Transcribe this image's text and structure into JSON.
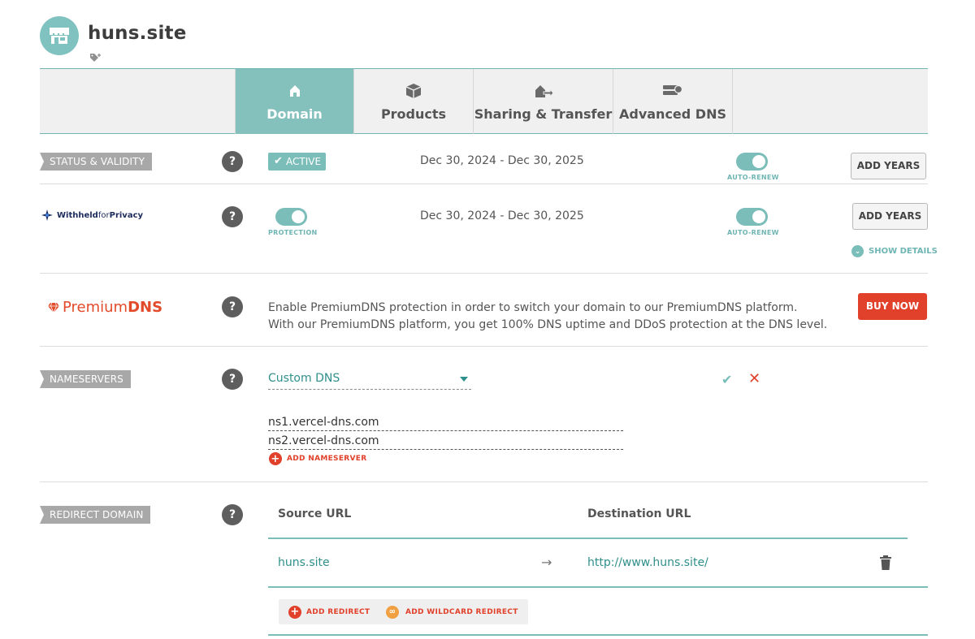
{
  "header": {
    "site_title": "huns.site"
  },
  "tabs": [
    {
      "label": "Domain",
      "icon": "home-icon",
      "active": true
    },
    {
      "label": "Products",
      "icon": "box-icon"
    },
    {
      "label": "Sharing & Transfer",
      "icon": "transfer-icon"
    },
    {
      "label": "Advanced DNS",
      "icon": "server-icon"
    }
  ],
  "status": {
    "label": "STATUS & VALIDITY",
    "badge": "ACTIVE",
    "dates": "Dec 30, 2024 - Dec 30, 2025",
    "toggle_caption": "AUTO-RENEW",
    "button": "ADD YEARS"
  },
  "privacy": {
    "logo_bold": "Withheld",
    "logo_thin": "for",
    "logo_end": "Privacy",
    "toggle_caption": "PROTECTION",
    "dates": "Dec 30, 2024 - Dec 30, 2025",
    "auto_caption": "AUTO-RENEW",
    "button": "ADD YEARS",
    "show_details": "SHOW DETAILS"
  },
  "premium": {
    "logo_thin": "Premium",
    "logo_bold": "DNS",
    "desc_line1": "Enable PremiumDNS protection in order to switch your domain to our PremiumDNS platform.",
    "desc_line2": "With our PremiumDNS platform, you get 100% DNS uptime and DDoS protection at the DNS level.",
    "button": "BUY NOW",
    "brand_color": "#e24a2a"
  },
  "nameservers": {
    "label": "NAMESERVERS",
    "select_value": "Custom DNS",
    "ns1": "ns1.vercel-dns.com",
    "ns2": "ns2.vercel-dns.com",
    "add_label": "ADD NAMESERVER"
  },
  "redirect": {
    "label": "REDIRECT DOMAIN",
    "col_source": "Source URL",
    "col_dest": "Destination URL",
    "source": "huns.site",
    "arrow": "→",
    "dest": "http://www.huns.site/",
    "add_redirect": "ADD REDIRECT",
    "add_wildcard": "ADD WILDCARD REDIRECT"
  },
  "help_glyph": "?",
  "colors": {
    "accent": "#7bbdb9",
    "danger": "#e1402a"
  }
}
